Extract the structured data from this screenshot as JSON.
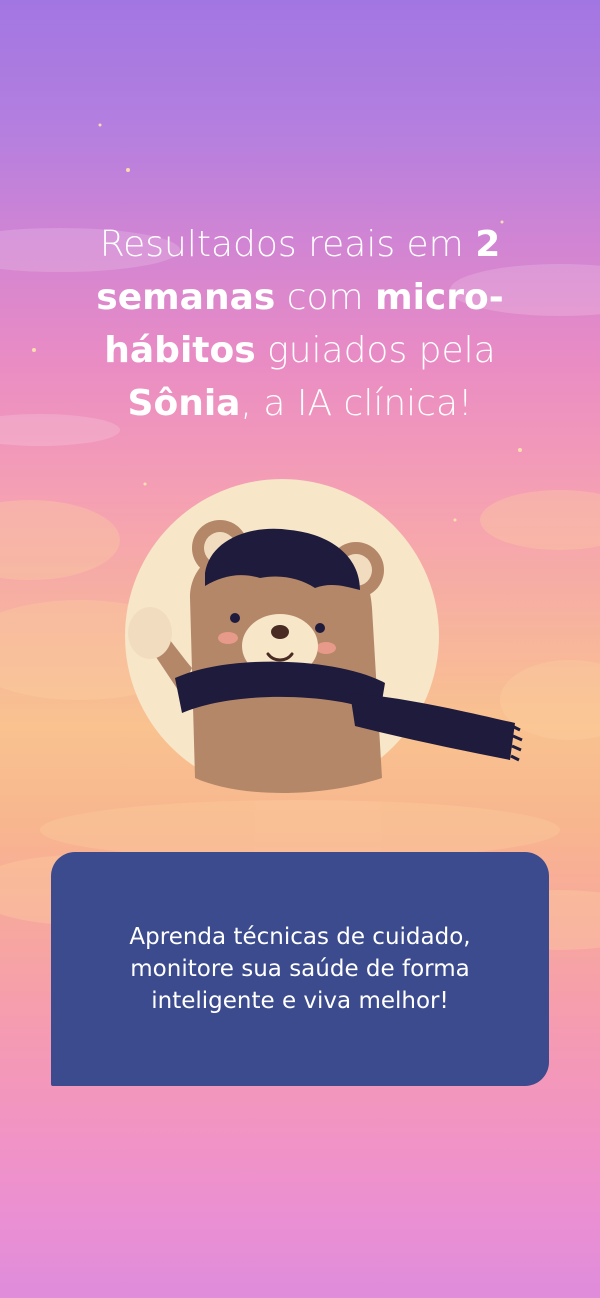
{
  "headline": {
    "p1": "Resultados reais em ",
    "b1": "2",
    "p2": " ",
    "b2": "semanas",
    "p3": " com ",
    "b3": "micro-",
    "p4": " ",
    "b4": "hábitos",
    "p5": " guiados pela ",
    "b5": "Sônia",
    "p6": ", a IA clínica!"
  },
  "mascot": {
    "icon": "waving-bear-with-scarf-icon",
    "circle_color": "#f7e6c8",
    "fur_color": "#b48769",
    "hair_color": "#1e1b3c"
  },
  "card": {
    "text": "Aprenda técnicas de cuidado, monitore sua saúde de forma inteligente e viva melhor!",
    "background": "#3b4b8e"
  }
}
